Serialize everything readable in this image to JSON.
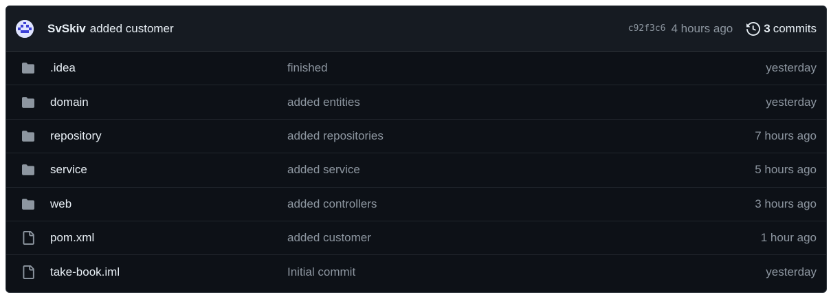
{
  "latest_commit": {
    "author": "SvSkiv",
    "message": "added customer",
    "sha": "c92f3c6",
    "time": "4 hours ago",
    "commit_count": "3",
    "commit_label": "commits"
  },
  "files": [
    {
      "type": "folder",
      "icon": "folder-icon",
      "name": ".idea",
      "commit": "finished",
      "age": "yesterday"
    },
    {
      "type": "folder",
      "icon": "folder-icon",
      "name": "domain",
      "commit": "added entities",
      "age": "yesterday"
    },
    {
      "type": "folder",
      "icon": "folder-icon",
      "name": "repository",
      "commit": "added repositories",
      "age": "7 hours ago"
    },
    {
      "type": "folder",
      "icon": "folder-icon",
      "name": "service",
      "commit": "added service",
      "age": "5 hours ago"
    },
    {
      "type": "folder",
      "icon": "folder-icon",
      "name": "web",
      "commit": "added controllers",
      "age": "3 hours ago"
    },
    {
      "type": "file",
      "icon": "file-icon",
      "name": "pom.xml",
      "commit": "added customer",
      "age": "1 hour ago"
    },
    {
      "type": "file",
      "icon": "file-icon",
      "name": "take-book.iml",
      "commit": "Initial commit",
      "age": "yesterday"
    }
  ],
  "colors": {
    "background": "#0d1117",
    "header_background": "#161b22",
    "border": "#30363d",
    "text_primary": "#e6edf3",
    "text_muted": "#8d96a0",
    "folder_icon": "#8d96a0"
  }
}
